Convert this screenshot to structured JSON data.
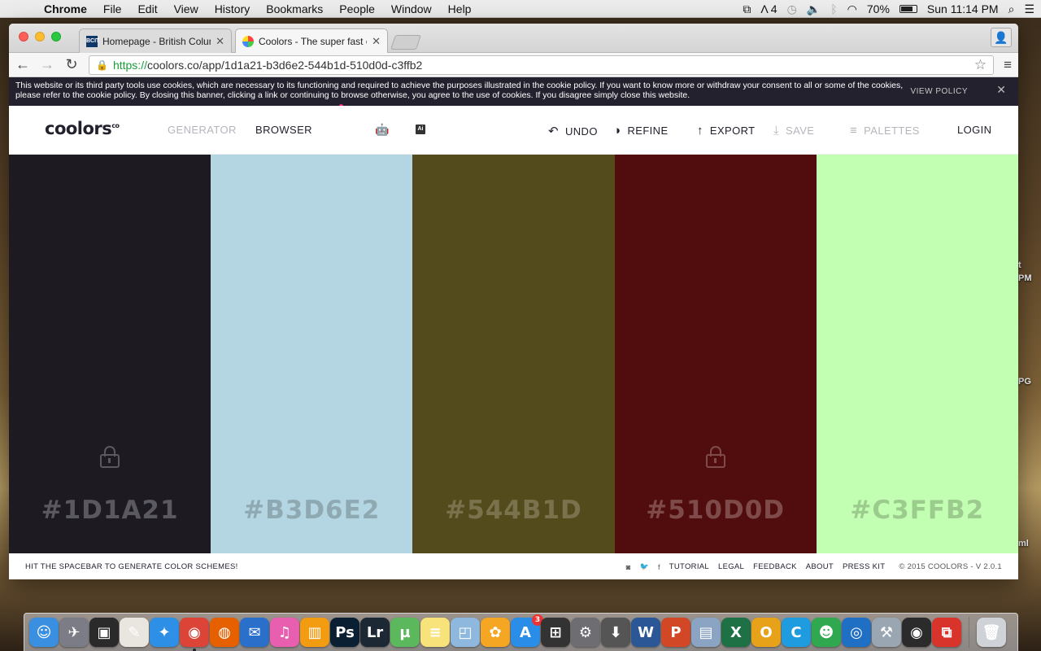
{
  "menubar": {
    "app_name": "Chrome",
    "items": [
      "File",
      "Edit",
      "View",
      "History",
      "Bookmarks",
      "People",
      "Window",
      "Help"
    ],
    "status": {
      "adobe_count": "4",
      "battery": "70%",
      "clock": "Sun 11:14 PM"
    }
  },
  "browser": {
    "tabs": [
      {
        "title": "Homepage - British Columbi",
        "favicon": "bcit-favicon",
        "favicon_text": "BCIT"
      },
      {
        "title": "Coolors - The super fast co",
        "favicon": "coolors-favicon"
      }
    ],
    "url_scheme": "https://",
    "url_rest": "coolors.co/app/1d1a21-b3d6e2-544b1d-510d0d-c3ffb2"
  },
  "cookie_banner": {
    "text": "This website or its third party tools use cookies, which are necessary to its functioning and required to achieve the purposes illustrated in the cookie policy. If you want to know more or withdraw your consent to all or some of the cookies, please refer to the cookie policy. By closing this banner, clicking a link or continuing to browse otherwise, you agree to the use of cookies. If you disagree simply close this website.",
    "policy_link": "VIEW POLICY",
    "close": "✕"
  },
  "appnav": {
    "logo": "coolors",
    "logo_mark": "co",
    "generator": "GENERATOR",
    "browser": "BROWSER",
    "ai_label": "Ai",
    "undo": "UNDO",
    "refine": "REFINE",
    "export": "EXPORT",
    "save": "SAVE",
    "palettes": "PALETTES",
    "login": "LOGIN"
  },
  "palette": [
    {
      "hex": "#1D1A21",
      "bg": "#1d1a21",
      "text_color": "#5a5860",
      "locked": true
    },
    {
      "hex": "#B3D6E2",
      "bg": "#b3d6e2",
      "text_color": "#8fa9b2",
      "locked": false
    },
    {
      "hex": "#544B1D",
      "bg": "#544b1d",
      "text_color": "#7a724d",
      "locked": false
    },
    {
      "hex": "#510D0D",
      "bg": "#510d0d",
      "text_color": "#7e4a4a",
      "locked": true
    },
    {
      "hex": "#C3FFB2",
      "bg": "#c3ffb2",
      "text_color": "#9ccb8e",
      "locked": false
    }
  ],
  "footer": {
    "hint": "HIT THE SPACEBAR TO GENERATE COLOR SCHEMES!",
    "tutorial": "TUTORIAL",
    "legal": "LEGAL",
    "feedback": "FEEDBACK",
    "about": "ABOUT",
    "press_kit": "PRESS KIT",
    "copyright": "© 2015 COOLORS - V 2.0.1"
  },
  "desktop_labels": [
    "t",
    "PM",
    "PG",
    "ml"
  ],
  "dock": [
    {
      "name": "finder-icon",
      "glyph": "☺",
      "color": "#3b8fe0"
    },
    {
      "name": "launchpad-icon",
      "glyph": "✈",
      "color": "#7c7c86"
    },
    {
      "name": "photo-booth-icon",
      "glyph": "▣",
      "color": "#2a2a2a"
    },
    {
      "name": "textedit-icon",
      "glyph": "✎",
      "color": "#e8e6df"
    },
    {
      "name": "safari-icon",
      "glyph": "✦",
      "color": "#2e8fe6"
    },
    {
      "name": "chrome-icon",
      "glyph": "◉",
      "color": "#db4437",
      "running": true
    },
    {
      "name": "firefox-icon",
      "glyph": "◍",
      "color": "#e66000"
    },
    {
      "name": "thunderbird-icon",
      "glyph": "✉",
      "color": "#2a6fc9"
    },
    {
      "name": "itunes-icon",
      "glyph": "♫",
      "color": "#e85fb0"
    },
    {
      "name": "ibooks-icon",
      "glyph": "▥",
      "color": "#f39c12"
    },
    {
      "name": "photoshop-icon",
      "glyph": "Ps",
      "color": "#0b1f33"
    },
    {
      "name": "lightroom-icon",
      "glyph": "Lr",
      "color": "#1c2833"
    },
    {
      "name": "utorrent-icon",
      "glyph": "µ",
      "color": "#5cb85c"
    },
    {
      "name": "notes-icon",
      "glyph": "≡",
      "color": "#f8e37a"
    },
    {
      "name": "preview-icon",
      "glyph": "◰",
      "color": "#8fb8de"
    },
    {
      "name": "photos-icon",
      "glyph": "✿",
      "color": "#f5a623"
    },
    {
      "name": "app-store-icon",
      "glyph": "A",
      "color": "#2a8ee8",
      "badge": "3"
    },
    {
      "name": "remote-desktop-icon",
      "glyph": "⊞",
      "color": "#333"
    },
    {
      "name": "system-preferences-icon",
      "glyph": "⚙",
      "color": "#6d6d72"
    },
    {
      "name": "installer-icon",
      "glyph": "⬇",
      "color": "#555"
    },
    {
      "name": "word-icon",
      "glyph": "W",
      "color": "#2b5797"
    },
    {
      "name": "powerpoint-icon",
      "glyph": "P",
      "color": "#d24726"
    },
    {
      "name": "image-capture-icon",
      "glyph": "▤",
      "color": "#8ba4c4"
    },
    {
      "name": "excel-icon",
      "glyph": "X",
      "color": "#1e7145"
    },
    {
      "name": "outlook-icon",
      "glyph": "O",
      "color": "#e8a21a"
    },
    {
      "name": "cyberduck-icon",
      "glyph": "C",
      "color": "#1f9be0"
    },
    {
      "name": "messenger-icon",
      "glyph": "☻",
      "color": "#2fa84f"
    },
    {
      "name": "network-icon",
      "glyph": "◎",
      "color": "#1f6fc4"
    },
    {
      "name": "migration-icon",
      "glyph": "⚒",
      "color": "#9aa7b3"
    },
    {
      "name": "airport-icon",
      "glyph": "◉",
      "color": "#2b2b2b"
    },
    {
      "name": "parallels-icon",
      "glyph": "⧉",
      "color": "#d9342b"
    },
    {
      "name": "trash-icon",
      "glyph": "🗑",
      "color": "#cfd2d6"
    }
  ]
}
